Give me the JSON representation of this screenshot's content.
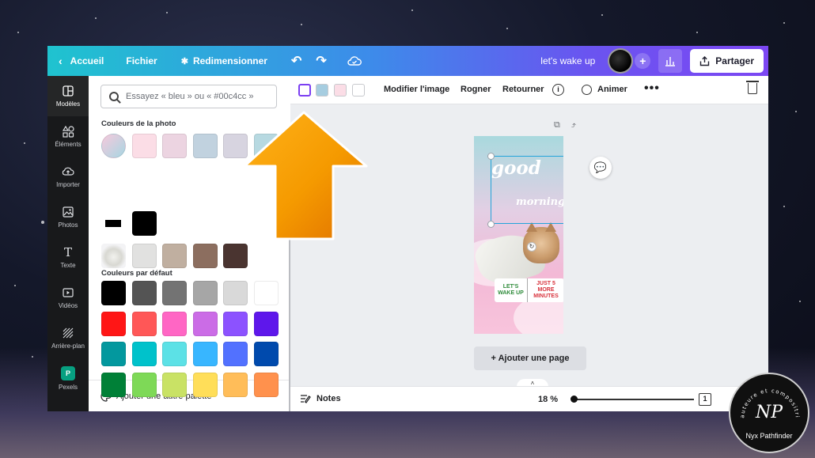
{
  "topbar": {
    "home_label": "Accueil",
    "file_label": "Fichier",
    "resize_label": "Redimensionner",
    "project_title": "let's wake up",
    "share_label": "Partager",
    "plus_icon": "plus-icon",
    "stats_icon": "bar-chart-icon"
  },
  "rail": {
    "items": [
      {
        "label": "Modèles",
        "icon": "layout-icon"
      },
      {
        "label": "Éléments",
        "icon": "shapes-icon"
      },
      {
        "label": "Importer",
        "icon": "upload-icon"
      },
      {
        "label": "Photos",
        "icon": "image-icon"
      },
      {
        "label": "Texte",
        "icon": "text-icon"
      },
      {
        "label": "Vidéos",
        "icon": "video-icon"
      },
      {
        "label": "Arrière-plan",
        "icon": "background-icon"
      },
      {
        "label": "Pexels",
        "icon": "pexels-icon"
      }
    ]
  },
  "panel": {
    "search_placeholder": "Essayez « bleu » ou « #00c4cc »",
    "photo_colors_title": "Couleurs de la photo",
    "default_colors_title": "Couleurs par défaut",
    "add_palette_label": "Ajouter une autre palette",
    "photo_colors_row1": [
      "#fbdde6",
      "#ecd4e1",
      "#c1d2df",
      "#d7d4e0",
      "#b7d9e1"
    ],
    "photo_colors_row3": [
      "#e1e1e0",
      "#c0afa0",
      "#8c6e5f",
      "#4a3430"
    ],
    "default_colors": [
      [
        "#000000",
        "#545454",
        "#737373",
        "#a6a6a6",
        "#d9d9d9",
        "#ffffff"
      ],
      [
        "#ff1616",
        "#ff5757",
        "#ff66c4",
        "#cb6ce6",
        "#8c52ff",
        "#5e17eb"
      ],
      [
        "#03989e",
        "#00c2cb",
        "#5ce1e6",
        "#38b6ff",
        "#5271ff",
        "#004aad"
      ],
      [
        "#008037",
        "#7ed957",
        "#c9e265",
        "#ffde59",
        "#ffbd59",
        "#ff914d"
      ]
    ]
  },
  "toolbar": {
    "swatches": [
      "#ffffff",
      "#a6cde0",
      "#fbdde6",
      "#ffffff"
    ],
    "edit_image_label": "Modifier l'image",
    "crop_label": "Rogner",
    "flip_label": "Retourner",
    "animate_label": "Animer"
  },
  "canvas": {
    "design_text_good": "good",
    "design_text_morning": "morning",
    "tag_left": "LET'S WAKE UP",
    "tag_right": "JUST 5 MORE MINUTES",
    "add_page_label": "+ Ajouter une page"
  },
  "footer": {
    "notes_label": "Notes",
    "zoom_label": "18 %",
    "page_count": "1"
  },
  "badge": {
    "name": "Nyx Pathfinder",
    "monogram": "NP",
    "arc_text": "auteure et compositrice"
  }
}
